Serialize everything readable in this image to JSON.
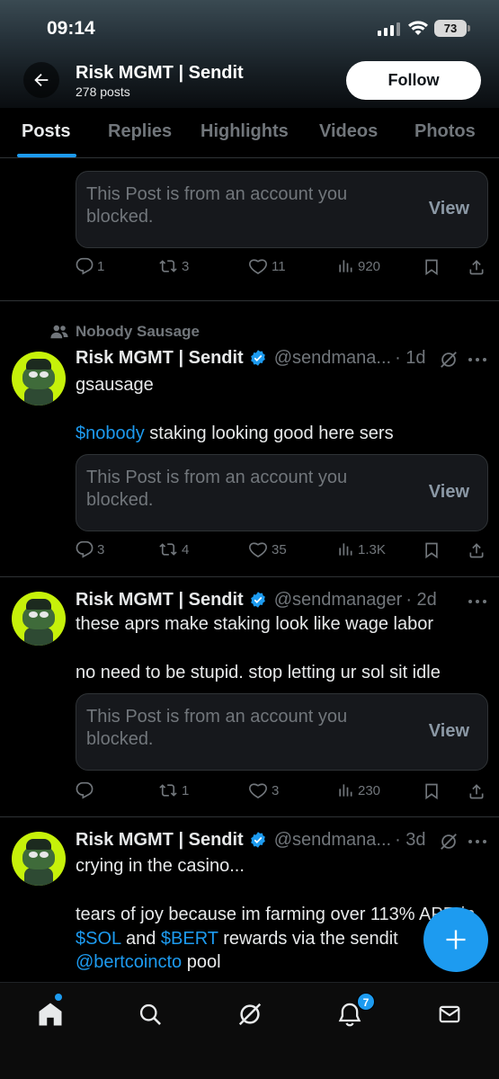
{
  "status_bar": {
    "time": "09:14",
    "battery": "73"
  },
  "header": {
    "title": "Risk MGMT | Sendit",
    "post_count": "278 posts",
    "follow_label": "Follow"
  },
  "tabs": [
    {
      "label": "Posts",
      "active": true
    },
    {
      "label": "Replies"
    },
    {
      "label": "Highlights"
    },
    {
      "label": "Videos"
    },
    {
      "label": "Photos"
    }
  ],
  "blocked_card": {
    "text": "This Post is from an account you blocked.",
    "view_label": "View"
  },
  "posts": [
    {
      "partial": true,
      "stats": {
        "replies": "1",
        "reposts": "3",
        "likes": "11",
        "views": "920"
      }
    },
    {
      "social_context": "Nobody Sausage",
      "author": "Risk MGMT | Sendit",
      "handle": "@sendmana...",
      "time": "· 1d",
      "line1": "gsausage",
      "line2_link": "$nobody",
      "line2_rest": " staking looking good here sers",
      "stats": {
        "replies": "3",
        "reposts": "4",
        "likes": "35",
        "views": "1.3K"
      }
    },
    {
      "author": "Risk MGMT | Sendit",
      "handle": "@sendmanager",
      "time": "· 2d",
      "line1": "these aprs make staking look like wage labor",
      "line2": "no need to be stupid. stop letting ur sol sit idle",
      "stats": {
        "replies": "",
        "reposts": "1",
        "likes": "3",
        "views": "230"
      }
    },
    {
      "author": "Risk MGMT | Sendit",
      "handle": "@sendmana...",
      "time": "· 3d",
      "line1": "crying in the casino...",
      "line2": "tears of joy because im farming over 113% APR in",
      "line3_link1": "$SOL",
      "line3_mid": " and ",
      "line3_link2": "$BERT",
      "line3_rest": " rewards via the sendit",
      "line4_link": "@bertcoincto",
      "line4_rest": " pool"
    }
  ],
  "bottom_nav": {
    "notification_count": "7"
  },
  "colors": {
    "accent": "#1d9bf0",
    "background": "#000000",
    "muted": "#71767b"
  }
}
